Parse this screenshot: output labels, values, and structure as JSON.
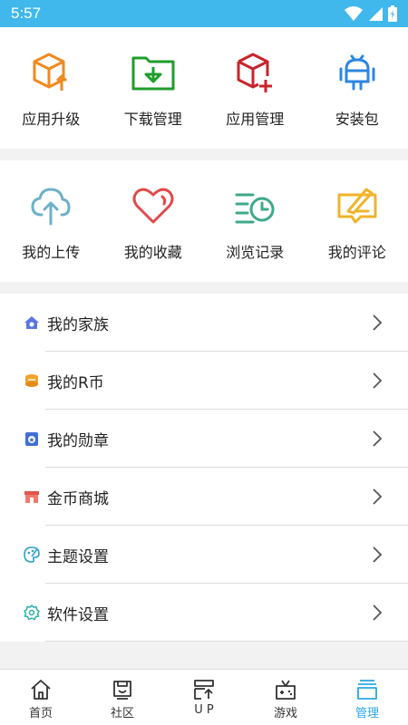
{
  "status": {
    "time": "5:57"
  },
  "quick": [
    {
      "label": "应用升级",
      "icon": "app-upgrade-icon"
    },
    {
      "label": "下载管理",
      "icon": "download-manage-icon"
    },
    {
      "label": "应用管理",
      "icon": "app-manage-icon"
    },
    {
      "label": "安装包",
      "icon": "install-package-icon"
    }
  ],
  "personal": [
    {
      "label": "我的上传",
      "icon": "upload-icon"
    },
    {
      "label": "我的收藏",
      "icon": "favorite-heart-icon"
    },
    {
      "label": "浏览记录",
      "icon": "history-icon"
    },
    {
      "label": "我的评论",
      "icon": "comment-icon"
    }
  ],
  "menu": [
    {
      "label": "我的家族",
      "icon": "family-icon"
    },
    {
      "label": "我的R币",
      "icon": "coin-icon"
    },
    {
      "label": "我的勋章",
      "icon": "medal-icon"
    },
    {
      "label": "金币商城",
      "icon": "shop-icon"
    },
    {
      "label": "主题设置",
      "icon": "palette-icon"
    },
    {
      "label": "软件设置",
      "icon": "settings-gear-icon"
    }
  ],
  "nav": [
    {
      "label": "首页",
      "icon": "home-icon"
    },
    {
      "label": "社区",
      "icon": "community-icon"
    },
    {
      "label": "U P",
      "icon": "up-icon"
    },
    {
      "label": "游戏",
      "icon": "game-icon"
    },
    {
      "label": "管理",
      "icon": "manage-icon",
      "active": true
    }
  ],
  "colors": {
    "accent": "#2aa7e6",
    "status_bar": "#40b8ec"
  }
}
